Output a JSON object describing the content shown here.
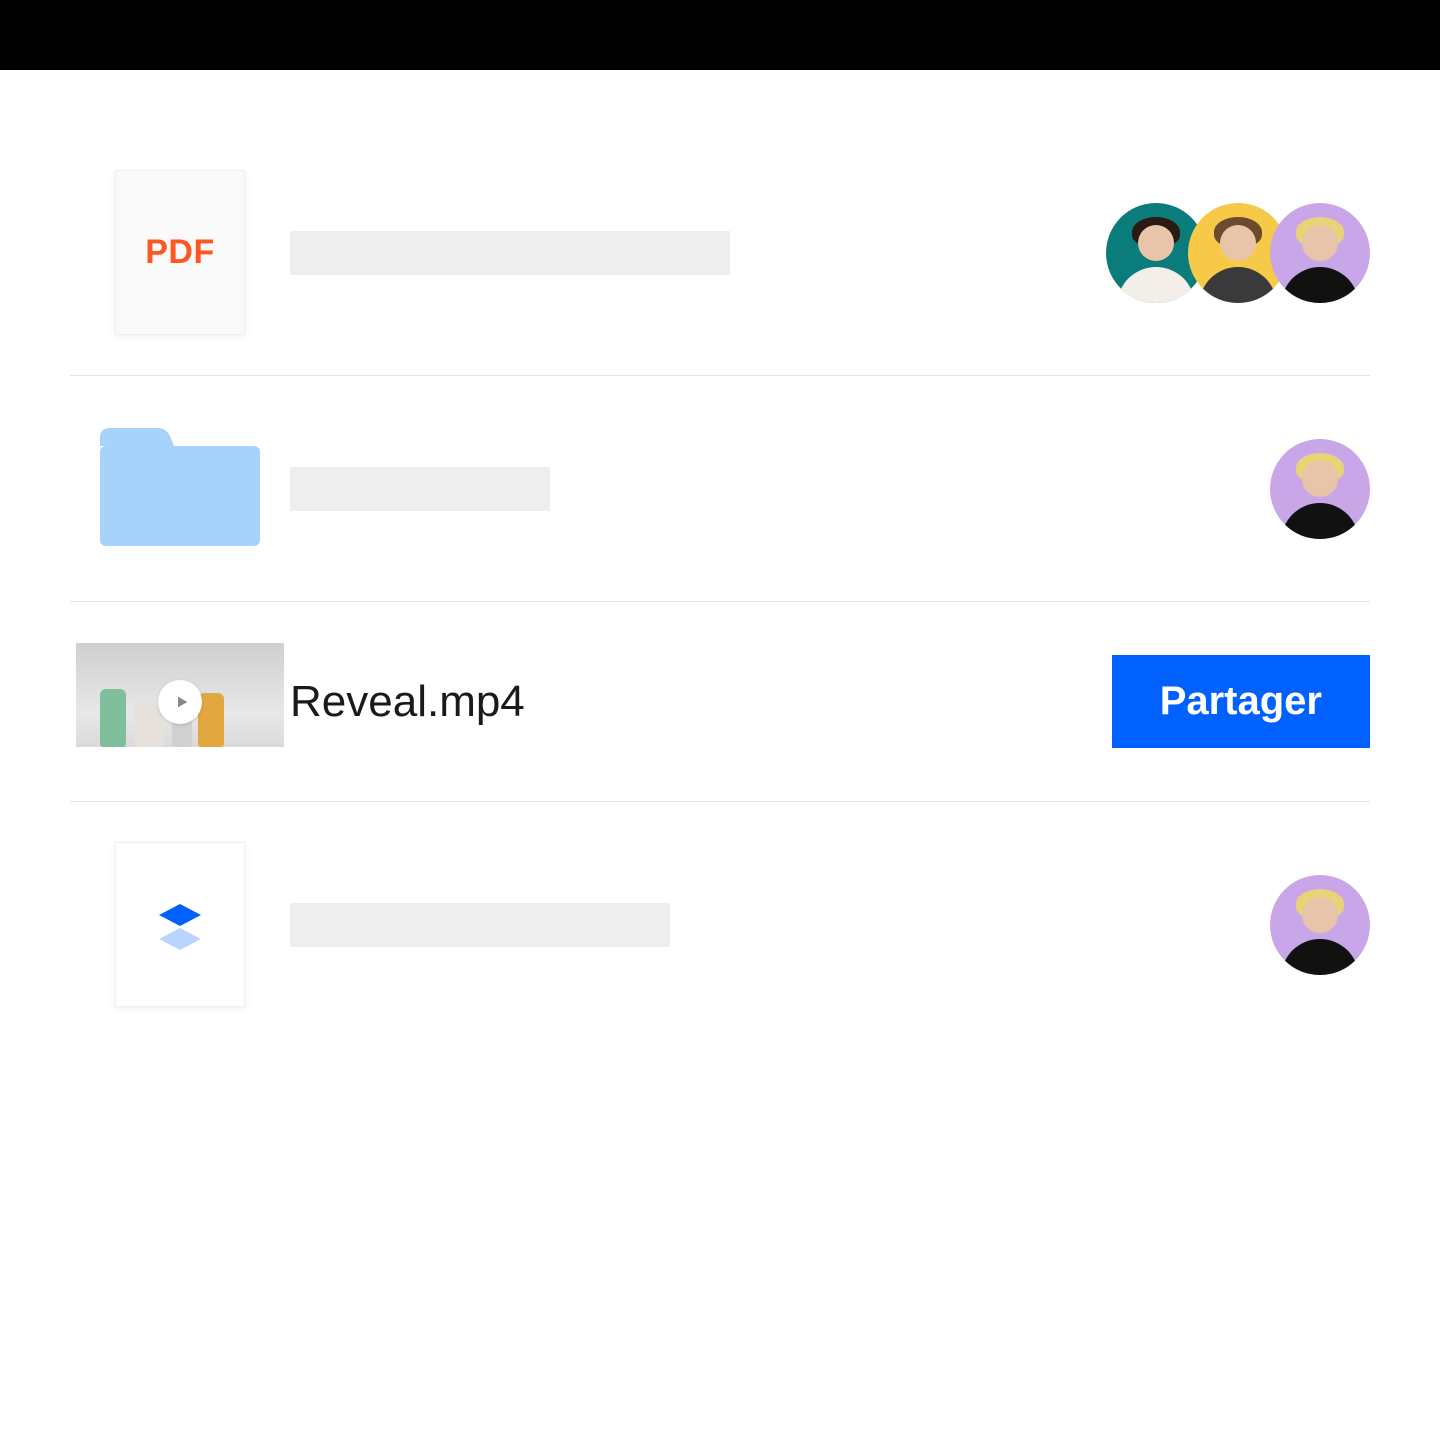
{
  "rows": {
    "pdf": {
      "badge_label": "PDF"
    },
    "video": {
      "filename": "Reveal.mp4",
      "share_label": "Partager"
    }
  },
  "avatars": {
    "colors": [
      "teal",
      "yellow",
      "lilac"
    ]
  },
  "accent_color": "#0061ff"
}
